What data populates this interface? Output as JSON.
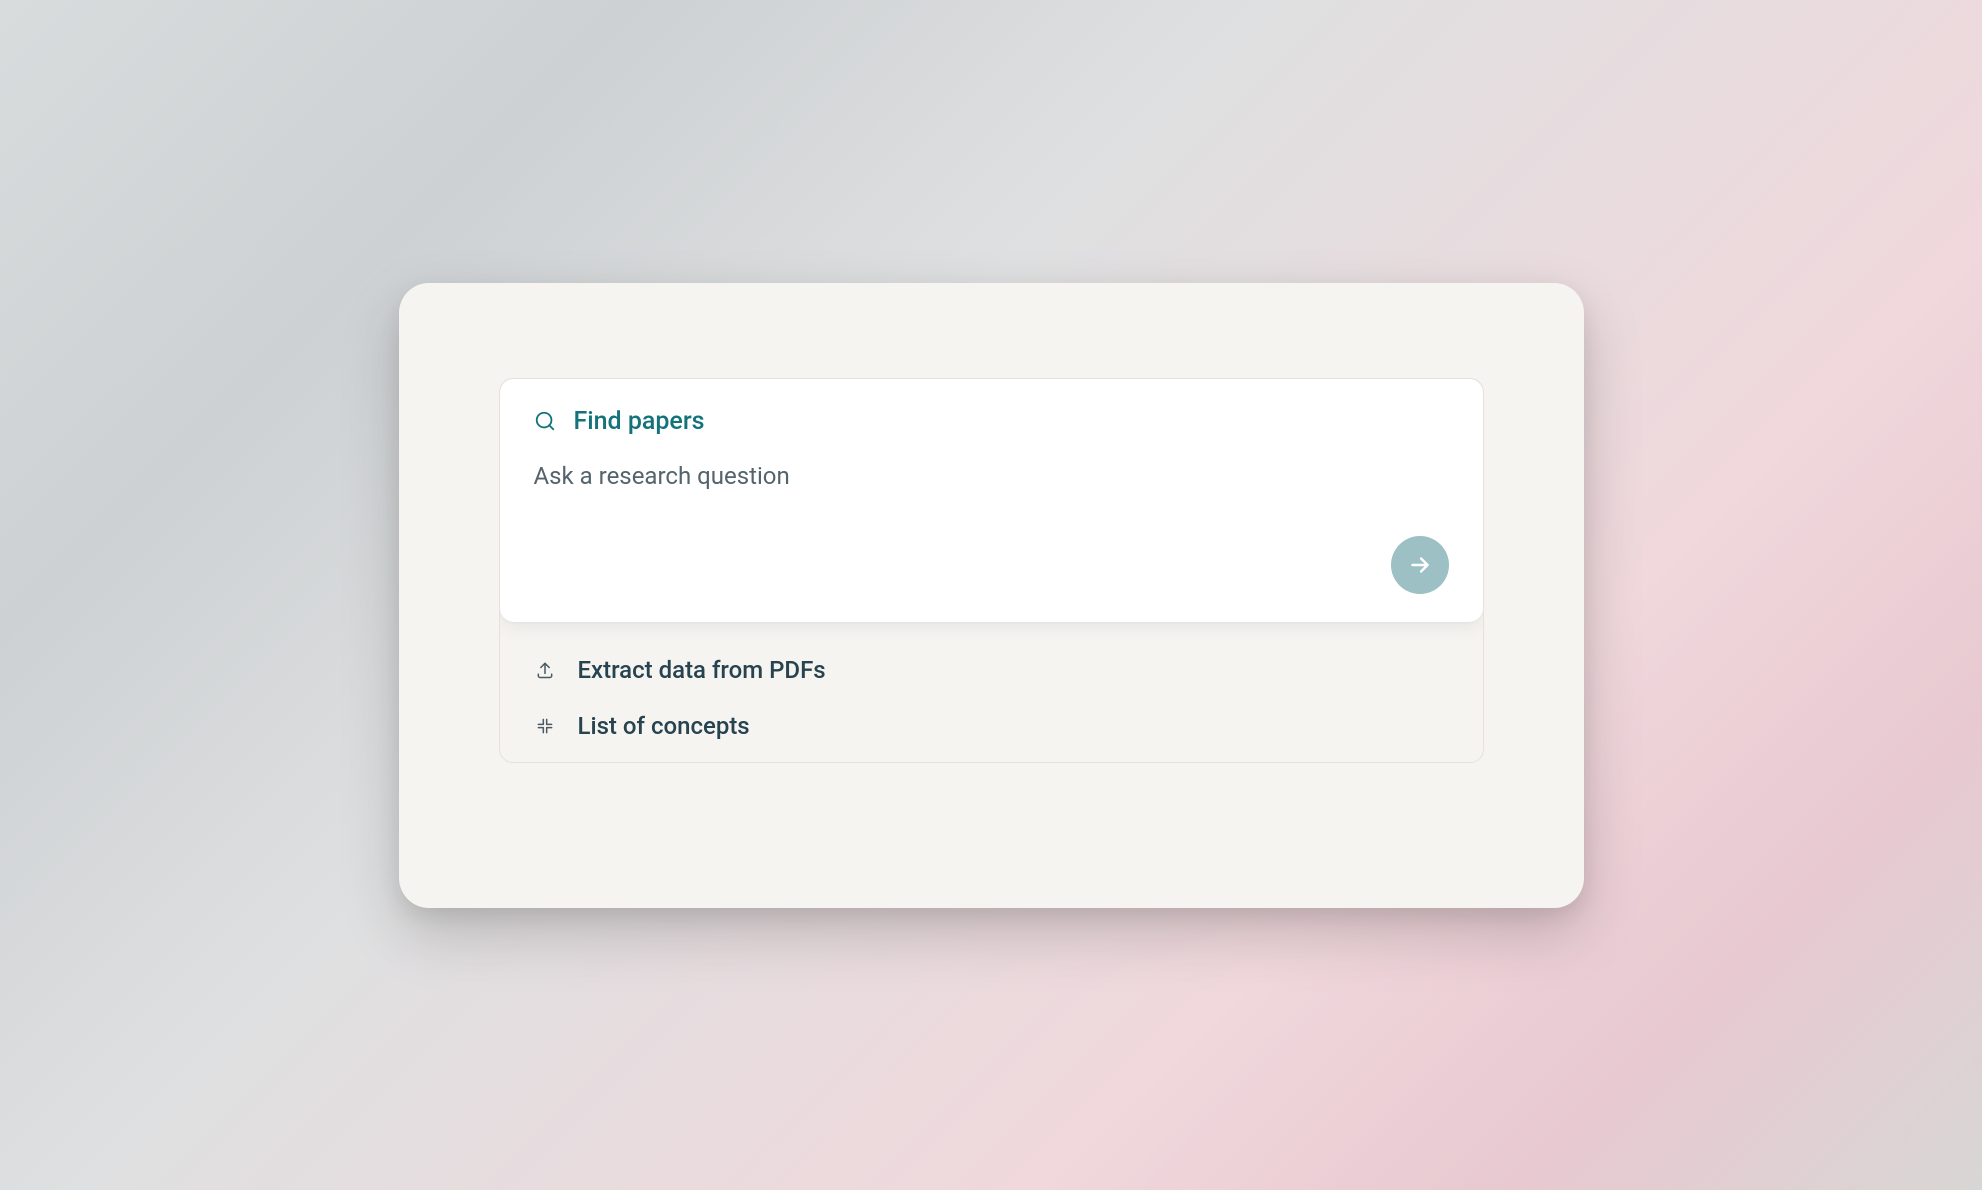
{
  "search": {
    "find_label": "Find papers",
    "placeholder": "Ask a research question",
    "value": ""
  },
  "options": [
    {
      "id": "extract",
      "label": "Extract data from PDFs"
    },
    {
      "id": "concepts",
      "label": "List of concepts"
    }
  ],
  "colors": {
    "accent": "#13727a",
    "submit_bg": "#9cc0c3",
    "panel_bg": "#f6f4f1",
    "card_bg": "#ffffff"
  }
}
